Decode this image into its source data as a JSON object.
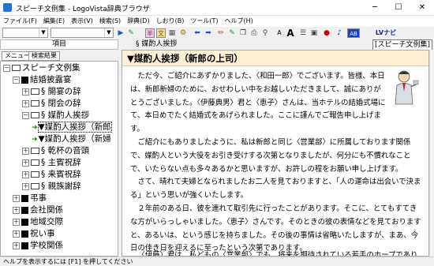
{
  "window": {
    "title": "スピーチ文例集 - LogoVista辞典ブラウザ",
    "minimize": "─",
    "maximize": "☐",
    "close": "✕"
  },
  "menu": [
    "ファイル(F)",
    "編集(E)",
    "表示(V)",
    "検索(S)",
    "辞典(D)",
    "しおり(B)",
    "ツール(T)",
    "ヘルプ(H)"
  ],
  "toolbar": {
    "t1": "半",
    "t2": "文",
    "t3": "A",
    "t4": "A",
    "t5": "AB",
    "t6": "LV",
    "t6b": "ナビ"
  },
  "left": {
    "header": "項目",
    "tabs": [
      "メニュー",
      "検索結果"
    ],
    "tree": [
      {
        "label": "スピーチ文例集",
        "kind": "folder",
        "exp": "－",
        "indent": 0
      },
      {
        "label": "結婚披露宴",
        "kind": "fill",
        "exp": "－",
        "indent": 1
      },
      {
        "label": "§ 開宴の辞",
        "kind": "folder",
        "exp": "＋",
        "indent": 2
      },
      {
        "label": "§ 閉会の辞",
        "kind": "folder",
        "exp": "＋",
        "indent": 2
      },
      {
        "label": "§ 媒酌人挨拶",
        "kind": "folder",
        "exp": "－",
        "indent": 2
      },
      {
        "label": "▼媒酌人挨拶（新郎",
        "kind": "arrow",
        "exp": "",
        "indent": 3
      },
      {
        "label": "▼媒酌人挨拶（新婦",
        "kind": "arrow",
        "exp": "",
        "indent": 3
      },
      {
        "label": "§ 乾杯の音頭",
        "kind": "folder",
        "exp": "＋",
        "indent": 2
      },
      {
        "label": "§ 主賓祝辞",
        "kind": "folder",
        "exp": "＋",
        "indent": 2
      },
      {
        "label": "§ 来賓祝辞",
        "kind": "folder",
        "exp": "＋",
        "indent": 2
      },
      {
        "label": "§ 親族謝辞",
        "kind": "folder",
        "exp": "＋",
        "indent": 2
      },
      {
        "label": "弔事",
        "kind": "fill",
        "exp": "＋",
        "indent": 1
      },
      {
        "label": "会社関係",
        "kind": "fill",
        "exp": "＋",
        "indent": 1
      },
      {
        "label": "地域交際",
        "kind": "fill",
        "exp": "＋",
        "indent": 1
      },
      {
        "label": "祝い事",
        "kind": "fill",
        "exp": "＋",
        "indent": 1
      },
      {
        "label": "学校関係",
        "kind": "fill",
        "exp": "＋",
        "indent": 1
      }
    ]
  },
  "right": {
    "breadcrumb": "§ 媒酌人挨拶",
    "book_tag": "[スピーチ文例集]",
    "title": "▼媒酌人挨拶（新郎の上司）",
    "paragraphs": [
      "ただ今、ご紹介にあずかりました、〈和田一郎〉でございます。皆様、本日は、新郎新婦のために、おせわしい中をお越しいただきまして、誠にありがとうございました。〈伊藤典男〉君と〈恵子〉さんは、当ホテルの結婚式場にて、本日めでたく結婚式をあげられました。ここに謹んでご報告申し上げます。",
      "ご紹介にもありましたように、私は新郎と同じ〈営業部〉に所属しております関係で、媒酌人という大役をお引き受けする次第となりましたが、何分にも不慣れなことで、いたらない点も多々あるかと思いますが、お許しの程をお願い申し上げます。",
      "さて、晴れて夫婦となられましたお二人を見ておりますと、「人の運命は出会いで決まる」という思いが強くいたします。",
      "２年前のある日、彼を連れて取引先に行ったことがあります。そこに、とてもすてきな方がいらっしゃいました。〈恵子〉さんです。そのときの彼の表情などを見ておりますと、あるいは、という感じを持ちました。その後の事情は省略いたしますが、まあ、今日の佳き日を迎えるに至ったという次第であります。",
      "〈伊藤〉君は、私どもの〈営業部〉でも、将来を期待されている若手のホープであります。"
    ]
  },
  "status": "ヘルプを表示するには [F1] を押してください"
}
